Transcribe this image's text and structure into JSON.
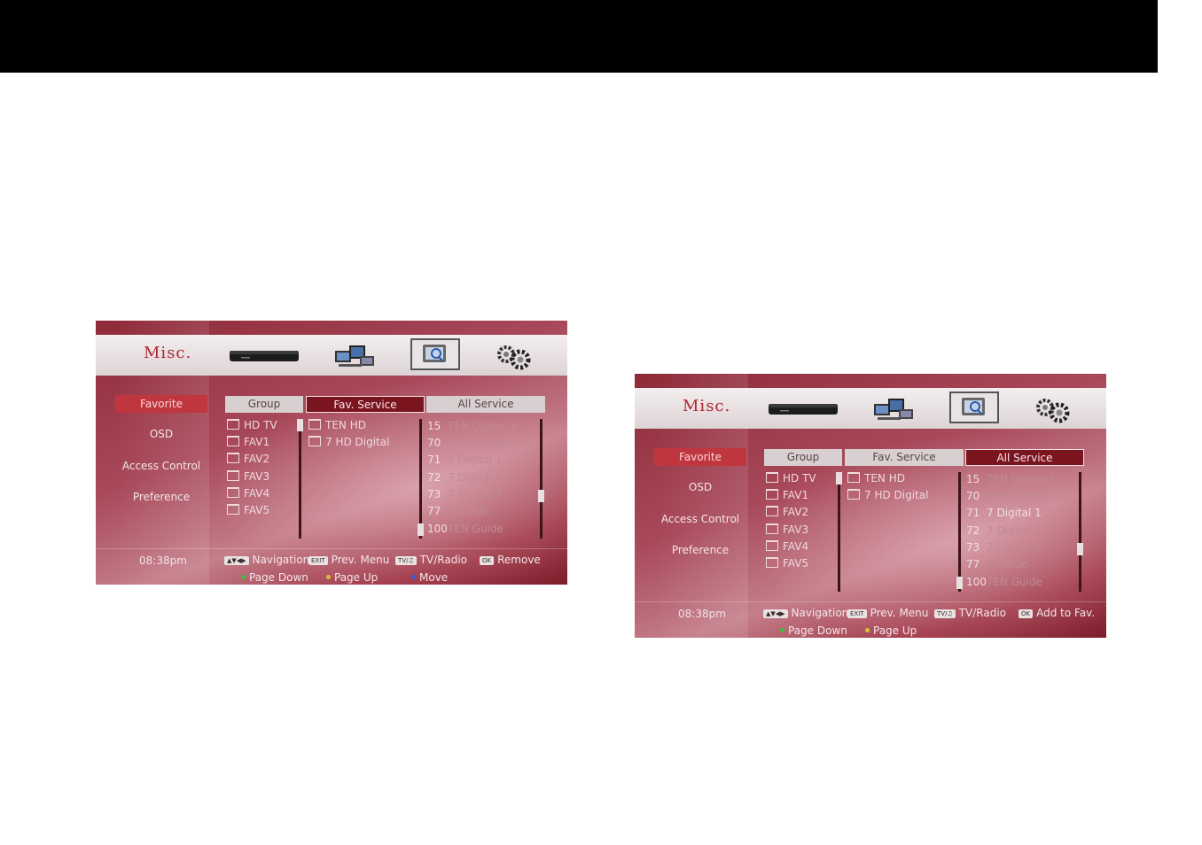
{
  "screens": [
    {
      "header": {
        "title": "Misc."
      },
      "menu": [
        "Favorite",
        "OSD",
        "Access Control",
        "Preference"
      ],
      "active_menu": "Favorite",
      "tabs": [
        "Group",
        "Fav. Service",
        "All Service"
      ],
      "active_tab": "Fav. Service",
      "groups": [
        "HD TV",
        "FAV1",
        "FAV2",
        "FAV3",
        "FAV4",
        "FAV5"
      ],
      "fav_services": [
        "TEN HD",
        "7 HD Digital"
      ],
      "all_services": [
        {
          "num": "15",
          "name": "TEN Digital 3",
          "dim": true
        },
        {
          "num": "70",
          "name": "7 HD Digital",
          "dim": true
        },
        {
          "num": "71",
          "name": "7 Digital 1",
          "dim": true
        },
        {
          "num": "72",
          "name": "7 Digital 2",
          "dim": true
        },
        {
          "num": "73",
          "name": "7 Digital 3",
          "dim": true
        },
        {
          "num": "77",
          "name": "7 Guide",
          "dim": true
        },
        {
          "num": "100",
          "name": "TEN Guide",
          "dim": true
        }
      ],
      "time": "08:38pm",
      "hints": {
        "navigation": "Navigation",
        "exit_key": "EXIT",
        "prev_menu": "Prev. Menu",
        "tvradio": "TV/Radio",
        "ok_key": "OK",
        "ok_action": "Remove",
        "page_down": "Page Down",
        "page_up": "Page Up",
        "move": "Move"
      }
    },
    {
      "header": {
        "title": "Misc."
      },
      "menu": [
        "Favorite",
        "OSD",
        "Access Control",
        "Preference"
      ],
      "active_menu": "Favorite",
      "tabs": [
        "Group",
        "Fav. Service",
        "All Service"
      ],
      "active_tab": "All Service",
      "groups": [
        "HD TV",
        "FAV1",
        "FAV2",
        "FAV3",
        "FAV4",
        "FAV5"
      ],
      "fav_services": [
        "TEN HD",
        "7 HD Digital"
      ],
      "all_services": [
        {
          "num": "15",
          "name": "TEN Digital 3",
          "dim": true
        },
        {
          "num": "70",
          "name": "7 HD Digital",
          "dim": true
        },
        {
          "num": "71",
          "name": "7 Digital 1",
          "dim": false
        },
        {
          "num": "72",
          "name": "7 Digital 2",
          "dim": true
        },
        {
          "num": "73",
          "name": "7 Digital 3",
          "dim": true
        },
        {
          "num": "77",
          "name": "7 Guide",
          "dim": true
        },
        {
          "num": "100",
          "name": "TEN Guide",
          "dim": true
        }
      ],
      "time": "08:38pm",
      "hints": {
        "navigation": "Navigation",
        "exit_key": "EXIT",
        "prev_menu": "Prev. Menu",
        "tvradio": "TV/Radio",
        "ok_key": "OK",
        "ok_action": "Add to Fav.",
        "page_down": "Page Down",
        "page_up": "Page Up"
      }
    }
  ],
  "colors": {
    "accent_red": "#c0363f",
    "active_tab": "#7a1520",
    "background": "#a8495a",
    "green_key": "#3fbf3f",
    "yellow_key": "#d8c23a",
    "blue_key": "#3a5bd8"
  }
}
